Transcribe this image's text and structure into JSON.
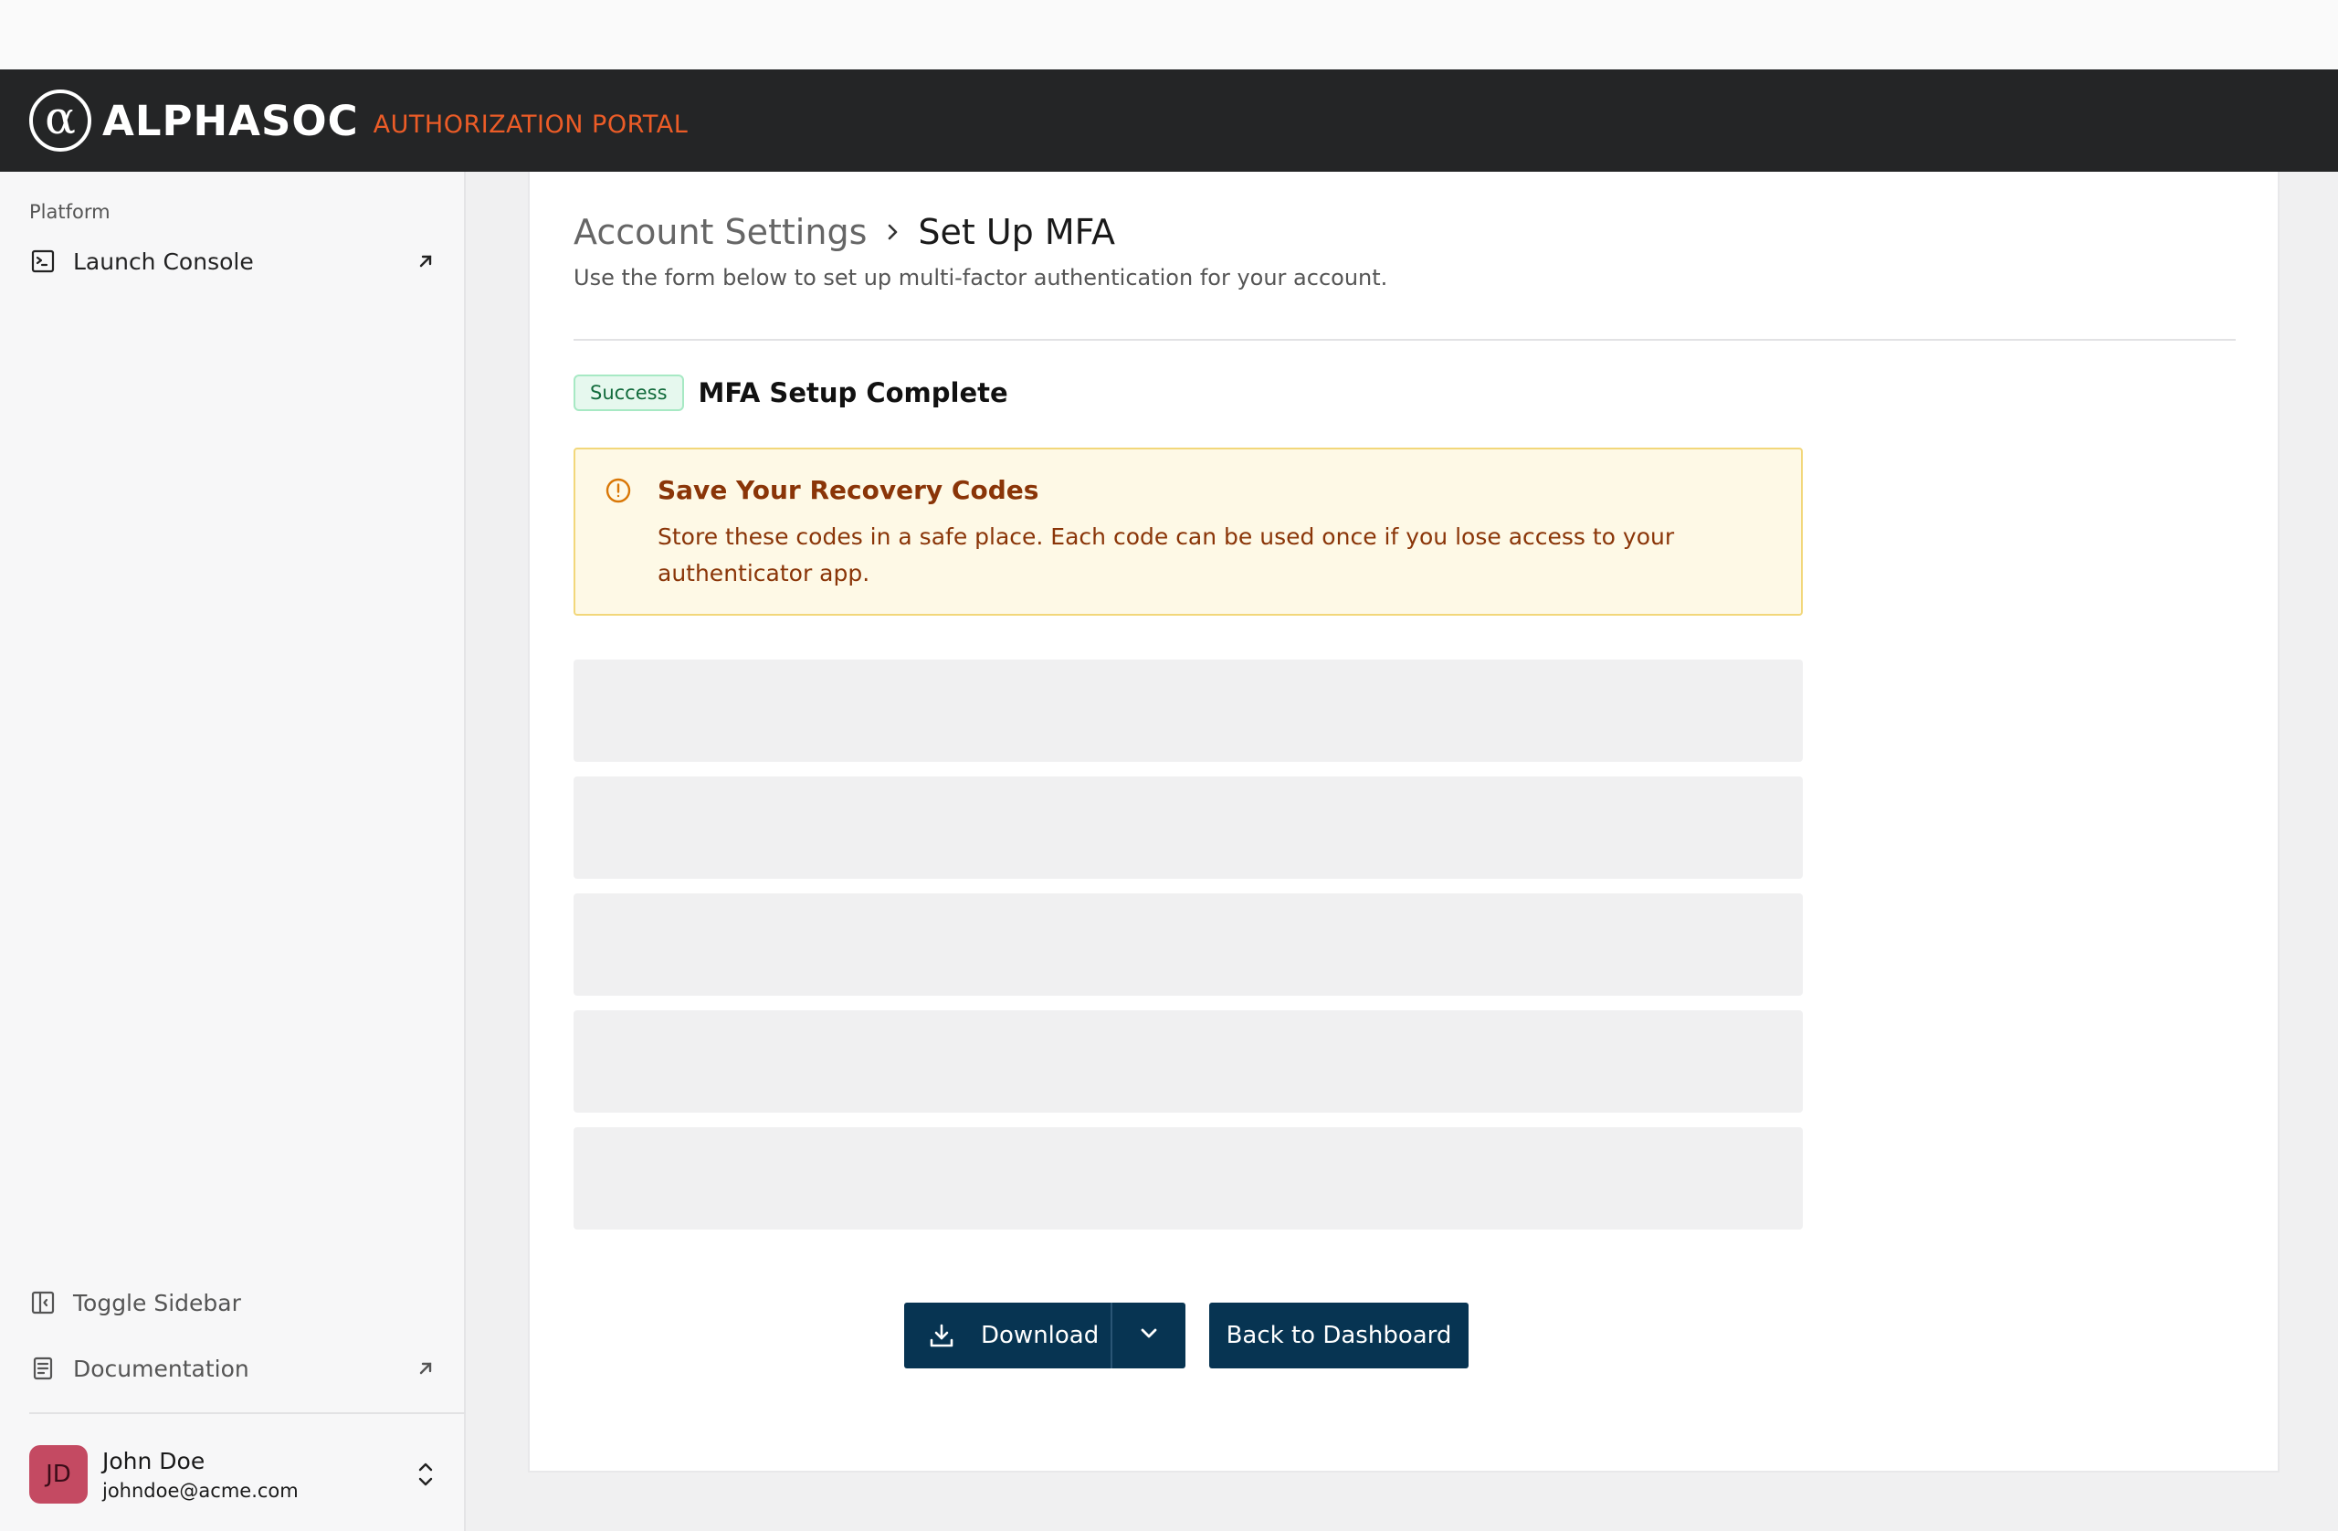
{
  "header": {
    "logo_glyph": "α",
    "brand": "ALPHASOC",
    "portal": "AUTHORIZATION PORTAL"
  },
  "sidebar": {
    "section_label": "Platform",
    "items": [
      {
        "label": "Launch Console",
        "icon": "terminal-icon",
        "external": true
      }
    ],
    "footer_items": [
      {
        "label": "Toggle Sidebar",
        "icon": "sidebar-toggle-icon"
      },
      {
        "label": "Documentation",
        "icon": "document-icon",
        "external": true
      }
    ],
    "user": {
      "initials": "JD",
      "name": "John Doe",
      "email": "johndoe@acme.com"
    }
  },
  "main": {
    "breadcrumb": {
      "parent": "Account Settings",
      "current": "Set Up MFA"
    },
    "subtitle": "Use the form below to set up multi-factor authentication for your account.",
    "status": {
      "badge": "Success",
      "title": "MFA Setup Complete"
    },
    "alert": {
      "title": "Save Your Recovery Codes",
      "body": "Store these codes in a safe place. Each code can be used once if you lose access to your authenticator app."
    },
    "recovery_codes": [
      "",
      "",
      "",
      "",
      ""
    ],
    "buttons": {
      "download": "Download",
      "back": "Back to Dashboard"
    }
  },
  "colors": {
    "header_bg": "#242526",
    "accent_orange": "#ec5c27",
    "primary_button": "#073452",
    "success_badge": "#e6f8ee",
    "warning_bg": "#fef9e6",
    "warning_text": "#8a3508",
    "avatar_bg": "#c44a62"
  }
}
